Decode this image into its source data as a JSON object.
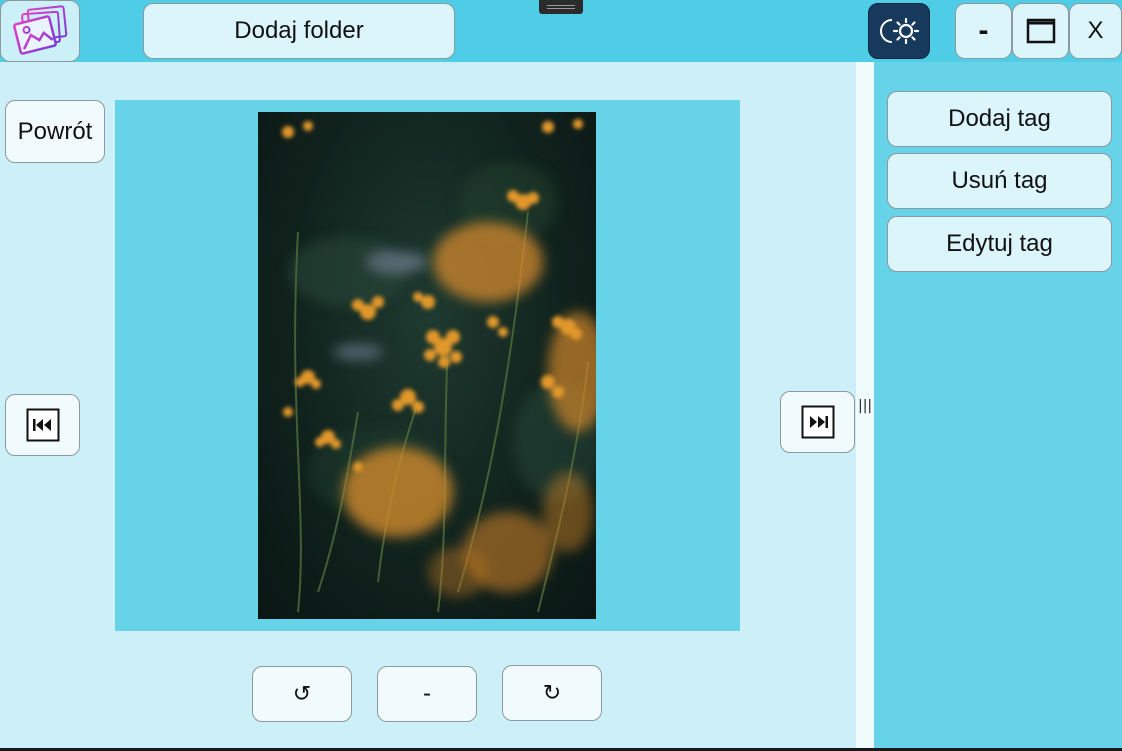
{
  "window": {
    "add_folder_label": "Dodaj folder",
    "minimize_label": "-",
    "maximize_label": "",
    "close_label": "X"
  },
  "viewer": {
    "back_label": "Powrót",
    "prev_icon": "skip-previous-icon",
    "next_icon": "skip-next-icon",
    "rotate_left_label": "↺",
    "reset_label": "-",
    "rotate_right_label": "↻"
  },
  "tags_panel": {
    "add_tag_label": "Dodaj tag",
    "remove_tag_label": "Usuń tag",
    "edit_tag_label": "Edytuj tag"
  },
  "splitter": {
    "grip_label": "|||"
  },
  "colors": {
    "titlebar": "#4fcce6",
    "content_bg": "#cdf0f8",
    "panel_bg": "#66d3e9",
    "image_frame": "#67d3e8",
    "button_bg": "#dcf5fa",
    "theme_button": "#173a5c"
  }
}
